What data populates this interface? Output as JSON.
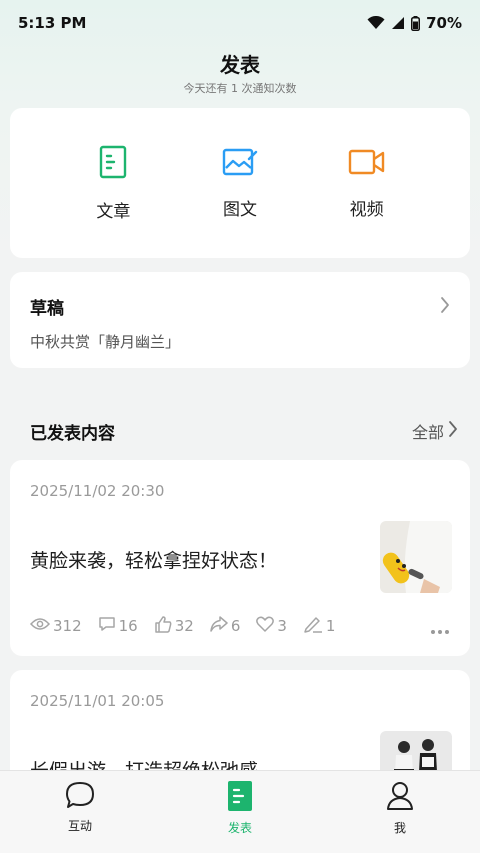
{
  "status_bar": {
    "time": "5:13 PM",
    "battery": "70%"
  },
  "header": {
    "title": "发表",
    "subtitle": "今天还有 1 次通知次数"
  },
  "publish": {
    "items": [
      {
        "label": "文章",
        "icon": "article-icon",
        "color": "#1db46e"
      },
      {
        "label": "图文",
        "icon": "image-text-icon",
        "color": "#2a9df4"
      },
      {
        "label": "视频",
        "icon": "video-icon",
        "color": "#f08a24"
      }
    ]
  },
  "draft": {
    "title": "草稿",
    "subtitle": "中秋共赏「静月幽兰」"
  },
  "published": {
    "title": "已发表内容",
    "all_label": "全部"
  },
  "posts": [
    {
      "date": "2025/11/02 20:30",
      "title": "黄脸来袭，轻松拿捏好状态！",
      "views": "312",
      "comments": "16",
      "likes": "32",
      "shares": "6",
      "favorites": "3",
      "edits": "1"
    },
    {
      "date": "2025/11/01 20:05",
      "title": "长假出游，打造超绝松弛感"
    }
  ],
  "tabs": [
    {
      "label": "互动"
    },
    {
      "label": "发表"
    },
    {
      "label": "我"
    }
  ],
  "colors": {
    "accent": "#1db46e",
    "card": "#ffffff",
    "muted": "#9a9a9a"
  }
}
